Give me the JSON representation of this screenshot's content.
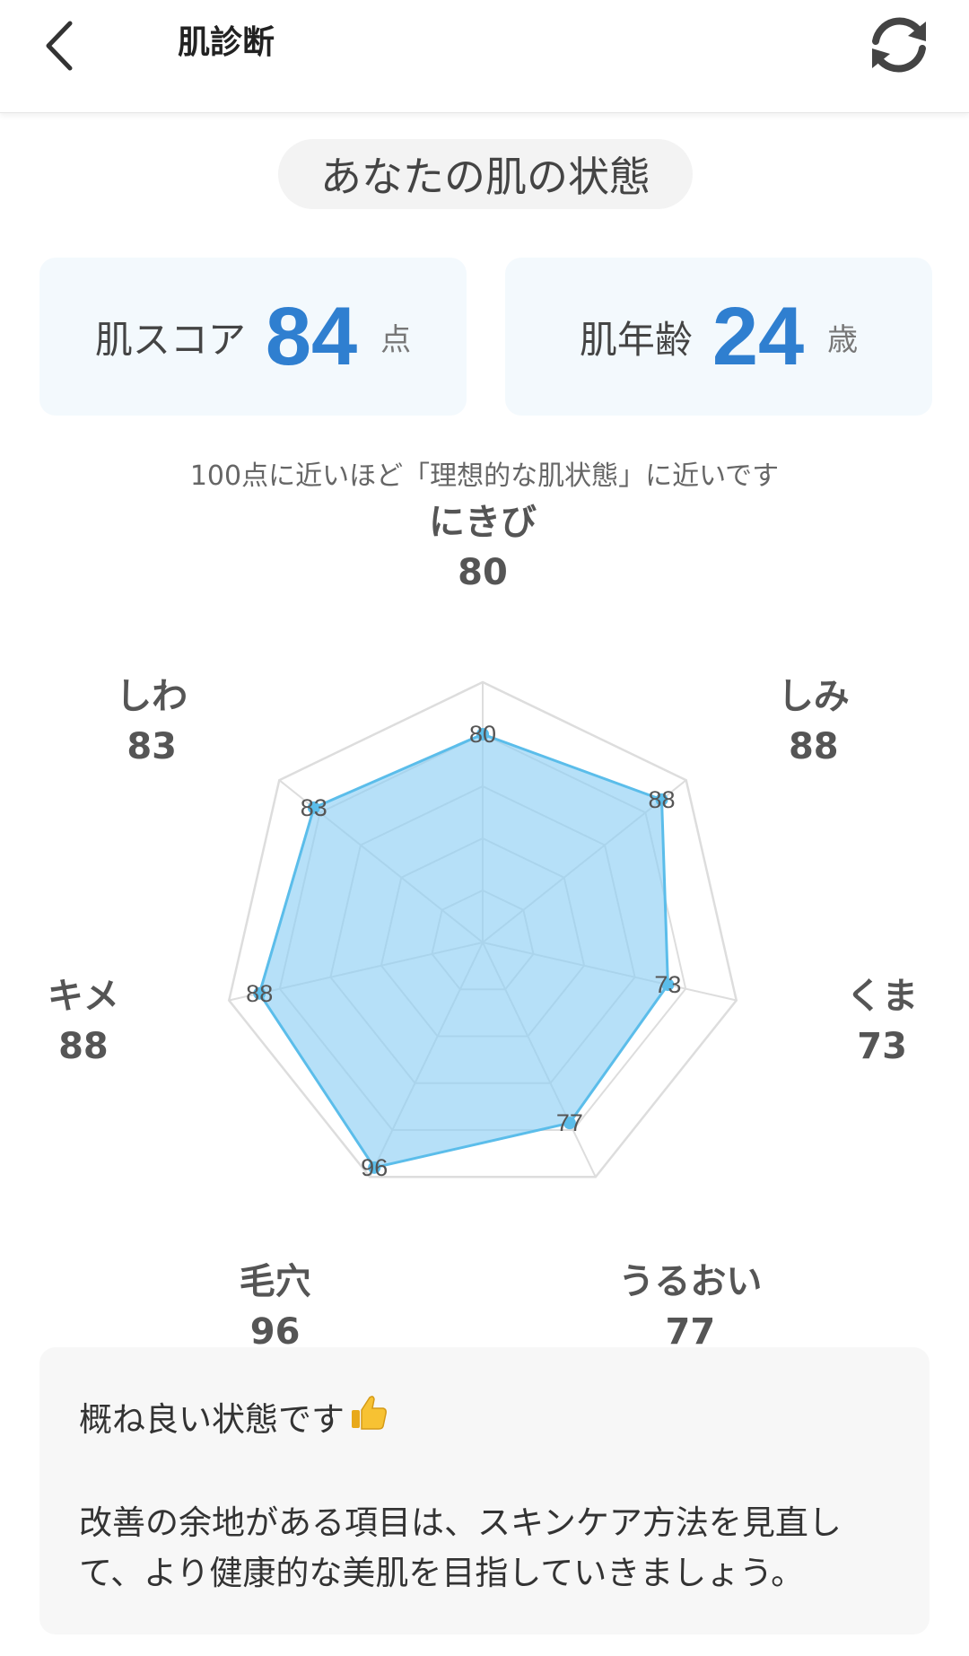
{
  "header": {
    "title": "肌診断",
    "back_icon": "chevron-left-icon",
    "refresh_icon": "refresh-icon"
  },
  "section_title": "あなたの肌の状態",
  "skin_score": {
    "label": "肌スコア",
    "value": "84",
    "unit": "点"
  },
  "skin_age": {
    "label": "肌年齢",
    "value": "24",
    "unit": "歳"
  },
  "note": "100点に近いほど「理想的な肌状態」に近いです",
  "colors": {
    "accent": "#2f7fd0",
    "radar_fill": "#8fd0f5",
    "radar_stroke": "#5bbdea"
  },
  "chart_data": {
    "type": "radar",
    "max": 100,
    "rings": 5,
    "axes": [
      {
        "name": "にきび",
        "value": 80,
        "label_value": "80"
      },
      {
        "name": "しみ",
        "value": 88,
        "label_value": "88"
      },
      {
        "name": "くま",
        "value": 73,
        "label_value": "73"
      },
      {
        "name": "うるおい",
        "value": 77,
        "label_value": "77"
      },
      {
        "name": "毛穴",
        "value": 96,
        "label_value": "96"
      },
      {
        "name": "キメ",
        "value": 88,
        "label_value": "88"
      },
      {
        "name": "しわ",
        "value": 83,
        "label_value": "83"
      }
    ]
  },
  "summary": {
    "headline": "概ね良い状態です",
    "headline_icon": "thumbs-up-icon",
    "body": "改善の余地がある項目は、スキンケア方法を見直して、より健康的な美肌を目指していきましょう。"
  }
}
